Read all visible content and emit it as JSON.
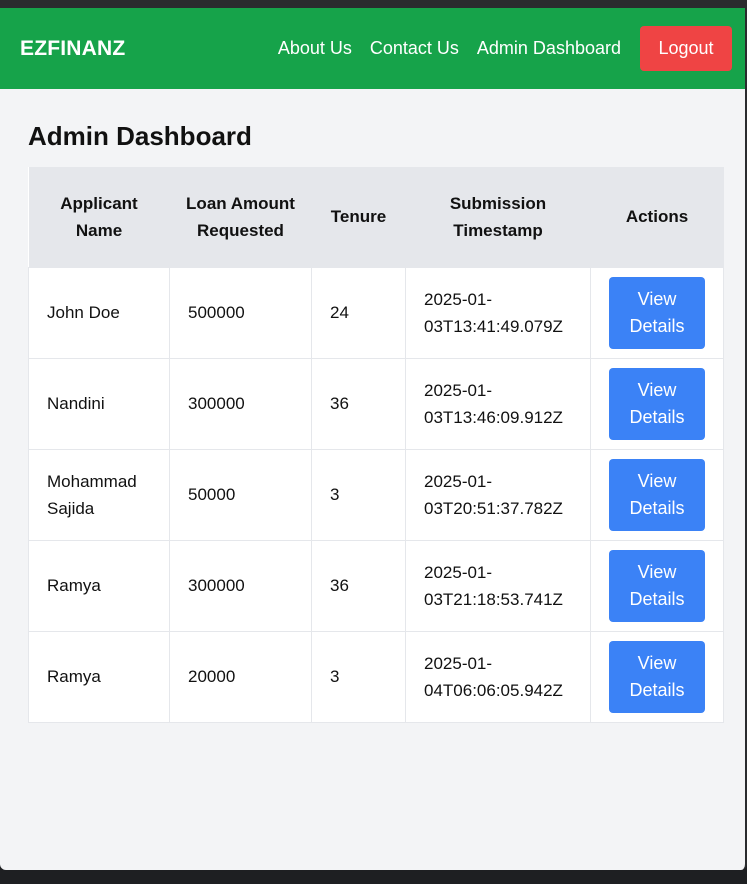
{
  "brand": {
    "name": "EZFINANZ"
  },
  "nav": {
    "links": [
      "About Us",
      "Contact Us",
      "Admin Dashboard"
    ],
    "logout_label": "Logout"
  },
  "page": {
    "title": "Admin Dashboard"
  },
  "table": {
    "headers": [
      "Applicant Name",
      "Loan Amount Requested",
      "Tenure",
      "Submission Timestamp",
      "Actions"
    ],
    "rows": [
      {
        "name": "John Doe",
        "amount": "500000",
        "tenure": "24",
        "timestamp_date": "2025-01-",
        "timestamp_time": "03T13:41:49.079Z",
        "action": "View Details"
      },
      {
        "name": "Nandini",
        "amount": "300000",
        "tenure": "36",
        "timestamp_date": "2025-01-",
        "timestamp_time": "03T13:46:09.912Z",
        "action": "View Details"
      },
      {
        "name": "Mohammad Sajida",
        "amount": "50000",
        "tenure": "3",
        "timestamp_date": "2025-01-",
        "timestamp_time": "03T20:51:37.782Z",
        "action": "View Details"
      },
      {
        "name": "Ramya",
        "amount": "300000",
        "tenure": "36",
        "timestamp_date": "2025-01-",
        "timestamp_time": "03T21:18:53.741Z",
        "action": "View Details"
      },
      {
        "name": "Ramya",
        "amount": "20000",
        "tenure": "3",
        "timestamp_date": "2025-01-",
        "timestamp_time": "04T06:06:05.942Z",
        "action": "View Details"
      }
    ]
  },
  "colors": {
    "navbar": "#16a34a",
    "logout": "#ef4444",
    "view_button": "#3b82f6",
    "header_row": "#e5e7eb",
    "background": "#f3f4f6"
  }
}
